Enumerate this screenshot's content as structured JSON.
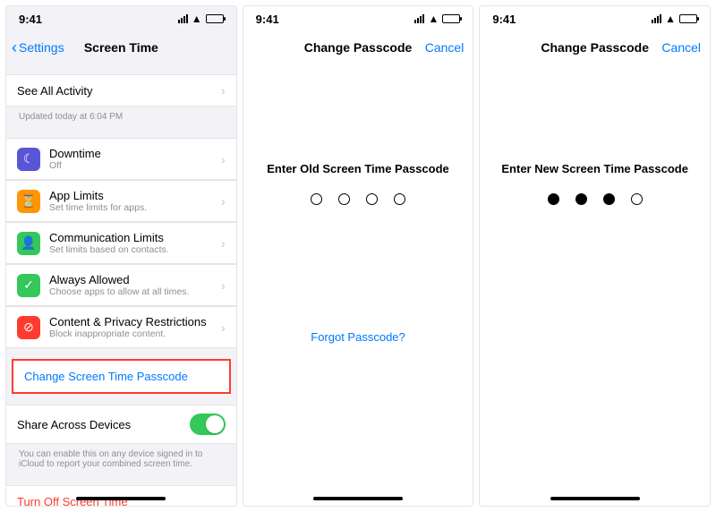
{
  "status": {
    "time": "9:41"
  },
  "screen1": {
    "back": "Settings",
    "title": "Screen Time",
    "see_all": "See All Activity",
    "updated": "Updated today at 6:04 PM",
    "items": [
      {
        "title": "Downtime",
        "sub": "Off",
        "glyph": "☾"
      },
      {
        "title": "App Limits",
        "sub": "Set time limits for apps.",
        "glyph": "⏳"
      },
      {
        "title": "Communication Limits",
        "sub": "Set limits based on contacts.",
        "glyph": "👤"
      },
      {
        "title": "Always Allowed",
        "sub": "Choose apps to allow at all times.",
        "glyph": "✓"
      },
      {
        "title": "Content & Privacy Restrictions",
        "sub": "Block inappropriate content.",
        "glyph": "⊘"
      }
    ],
    "change_passcode": "Change Screen Time Passcode",
    "share_label": "Share Across Devices",
    "share_footer": "You can enable this on any device signed in to iCloud to report your combined screen time.",
    "turn_off": "Turn Off Screen Time"
  },
  "screen2": {
    "title": "Change Passcode",
    "cancel": "Cancel",
    "prompt": "Enter Old Screen Time Passcode",
    "filled": 0,
    "forgot": "Forgot Passcode?"
  },
  "screen3": {
    "title": "Change Passcode",
    "cancel": "Cancel",
    "prompt": "Enter New Screen Time Passcode",
    "filled": 3
  }
}
